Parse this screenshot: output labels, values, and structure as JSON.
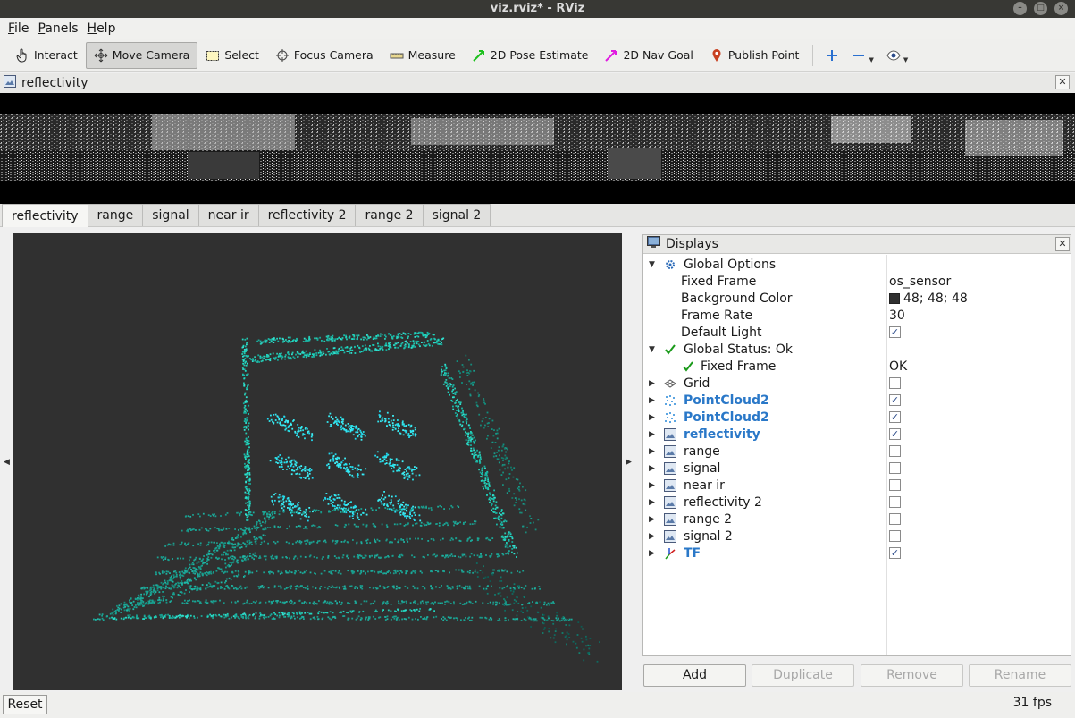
{
  "window": {
    "title": "viz.rviz* - RViz"
  },
  "menu": {
    "items": [
      {
        "accel": "F",
        "rest": "ile"
      },
      {
        "accel": "P",
        "rest": "anels"
      },
      {
        "accel": "H",
        "rest": "elp"
      }
    ]
  },
  "toolbar": {
    "interact": "Interact",
    "move_camera": "Move Camera",
    "select": "Select",
    "focus_camera": "Focus Camera",
    "measure": "Measure",
    "pose_estimate": "2D Pose Estimate",
    "nav_goal": "2D Nav Goal",
    "publish_point": "Publish Point"
  },
  "image_panel": {
    "title": "reflectivity"
  },
  "tabs": [
    "reflectivity",
    "range",
    "signal",
    "near ir",
    "reflectivity 2",
    "range 2",
    "signal 2"
  ],
  "displays": {
    "title": "Displays",
    "rows": [
      {
        "label": "Global Options",
        "expanded": true,
        "icon": "gear-icon"
      },
      {
        "label": "Fixed Frame",
        "value": "os_sensor"
      },
      {
        "label": "Background Color",
        "value": "48; 48; 48",
        "swatch": "#303030"
      },
      {
        "label": "Frame Rate",
        "value": "30"
      },
      {
        "label": "Default Light",
        "checked": true
      },
      {
        "label": "Global Status: Ok",
        "expanded": true,
        "icon": "check-icon"
      },
      {
        "label": "Fixed Frame",
        "value": "OK",
        "icon": "check-icon"
      },
      {
        "label": "Grid",
        "icon": "grid-icon",
        "checked": false
      },
      {
        "label": "PointCloud2",
        "icon": "pointcloud-icon",
        "checked": true,
        "highlight": true
      },
      {
        "label": "PointCloud2",
        "icon": "pointcloud-icon",
        "checked": true,
        "highlight": true
      },
      {
        "label": "reflectivity",
        "icon": "image-icon",
        "checked": true,
        "highlight": true
      },
      {
        "label": "range",
        "icon": "image-icon",
        "checked": false
      },
      {
        "label": "signal",
        "icon": "image-icon",
        "checked": false
      },
      {
        "label": "near ir",
        "icon": "image-icon",
        "checked": false
      },
      {
        "label": "reflectivity 2",
        "icon": "image-icon",
        "checked": false
      },
      {
        "label": "range 2",
        "icon": "image-icon",
        "checked": false
      },
      {
        "label": "signal 2",
        "icon": "image-icon",
        "checked": false
      },
      {
        "label": "TF",
        "icon": "tf-icon",
        "checked": true,
        "highlight": true
      }
    ]
  },
  "buttons": {
    "add": "Add",
    "duplicate": "Duplicate",
    "remove": "Remove",
    "rename": "Rename"
  },
  "status": {
    "reset": "Reset",
    "fps": "31 fps"
  },
  "colors": {
    "viewport_bg": "#303030",
    "point_color": "#20d8c0",
    "highlight": "#2a78c8"
  }
}
